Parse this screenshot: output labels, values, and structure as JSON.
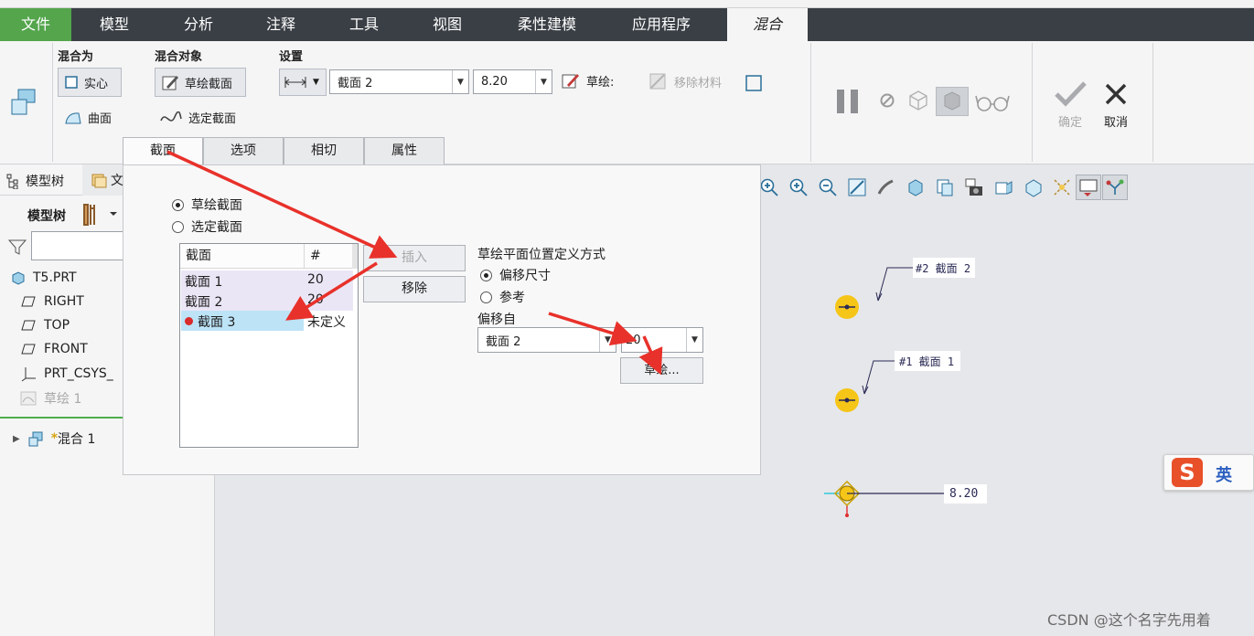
{
  "menubar": {
    "tabs": [
      "文件",
      "模型",
      "分析",
      "注释",
      "工具",
      "视图",
      "柔性建模",
      "应用程序",
      "混合"
    ]
  },
  "ribbon": {
    "blend_as": {
      "title": "混合为",
      "solid": "实心",
      "surface": "曲面"
    },
    "blend_target": {
      "title": "混合对象",
      "sketch_section": "草绘截面",
      "select_section": "选定截面"
    },
    "settings": {
      "title": "设置",
      "section_combo": "截面 2",
      "value_combo": "8.20",
      "sketch": "草绘:",
      "remove_material": "移除材料"
    },
    "confirm": "确定",
    "cancel": "取消"
  },
  "dashboard_tabs": [
    "截面",
    "选项",
    "相切",
    "属性"
  ],
  "left_panel": {
    "tab_model_tree": "模型树",
    "tab_layer": "文",
    "tree_label": "模型树",
    "search_placeholder": "",
    "items": [
      {
        "label": "T5.PRT",
        "icon": "part-icon"
      },
      {
        "label": "RIGHT",
        "icon": "datum-plane-icon"
      },
      {
        "label": "TOP",
        "icon": "datum-plane-icon"
      },
      {
        "label": "FRONT",
        "icon": "datum-plane-icon"
      },
      {
        "label": "PRT_CSYS_",
        "icon": "csys-icon"
      },
      {
        "label": "草绘 1",
        "icon": "sketch-icon"
      },
      {
        "label": "混合 1",
        "icon": "blend-icon"
      }
    ],
    "blend_marker": "*"
  },
  "dialog": {
    "radio_sketch": "草绘截面",
    "radio_select": "选定截面",
    "table": {
      "headers": [
        "截面",
        "#"
      ],
      "rows": [
        {
          "name": "截面 1",
          "value": "20"
        },
        {
          "name": "截面 2",
          "value": "20"
        },
        {
          "name": "截面 3",
          "value": "未定义"
        }
      ]
    },
    "insert": "插入",
    "remove": "移除",
    "placement_title": "草绘平面位置定义方式",
    "radio_offset": "偏移尺寸",
    "radio_reference": "参考",
    "offset_from_label": "偏移自",
    "offset_from_value": "截面 2",
    "offset_value": "20",
    "sketch_button": "草绘..."
  },
  "canvas": {
    "label_section2": "#2 截面 2",
    "label_section1": "#1 截面 1",
    "dimension": "8.20",
    "ime_label": "英"
  },
  "watermark": "CSDN @这个名字先用着",
  "colors": {
    "menubar": "#3a3f45",
    "file_tab": "#54a54c",
    "selected_row": "#bde3f7",
    "arrow": "#e8312a",
    "marker": "#f5c518"
  }
}
